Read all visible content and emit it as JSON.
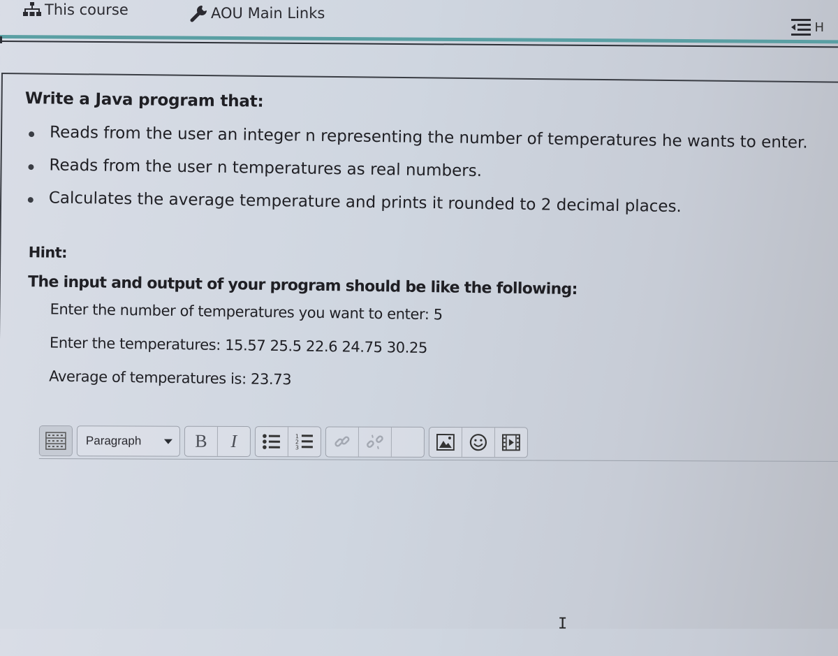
{
  "nav": {
    "this_course": "This course",
    "main_links": "AOU Main Links",
    "drawer_toggle_partial": "H"
  },
  "question": {
    "title": "Write a Java program that:",
    "requirements": [
      "Reads from the user an integer n representing the number of temperatures he wants to enter.",
      "Reads from the user n temperatures as real numbers.",
      "Calculates the average temperature and prints it rounded to 2 decimal places."
    ],
    "hint_label": "Hint:",
    "io_heading": "The input and output of your program should be like the following:",
    "sample_io": [
      "Enter the number of temperatures you want to enter: 5",
      "Enter the temperatures: 15.57 25.5 22.6 24.75 30.25",
      "Average of temperatures is: 23.73"
    ]
  },
  "editor": {
    "format_select": "Paragraph",
    "bold_label": "B",
    "italic_label": "I",
    "toolbar_icons": [
      "toolbar-toggle-icon",
      "bullet-list-icon",
      "numbered-list-icon",
      "link-icon",
      "unlink-icon",
      "image-icon",
      "emoji-icon",
      "media-icon"
    ],
    "content": ""
  }
}
